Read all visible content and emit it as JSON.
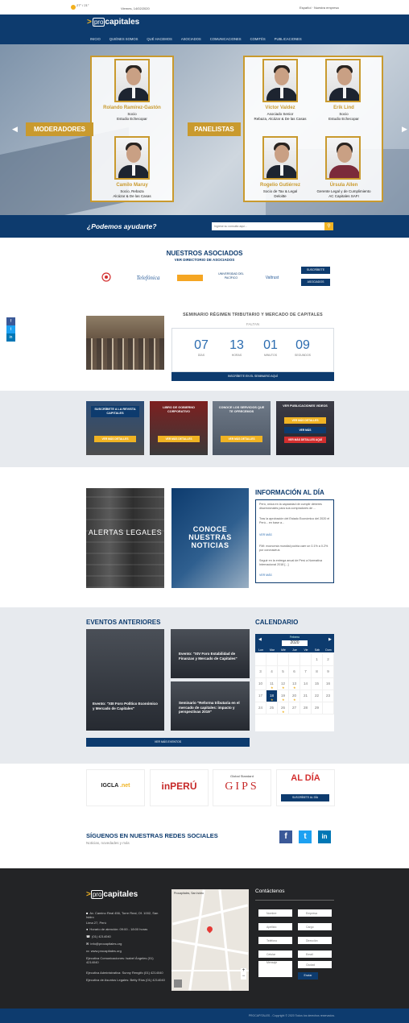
{
  "topbar": {
    "temp": "27° / 21°",
    "temp_sub": "Lima",
    "date": "Viernes, 14/02/2020",
    "right": "Español · Nuestra empresa"
  },
  "header": {
    "logo_pro": "pro",
    "logo_rest": "capitales"
  },
  "menu": [
    "INICIO",
    "QUIÉNES SOMOS",
    "QUÉ HACEMOS",
    "ASOCIADOS",
    "COMUNICACIONES",
    "COMITÉS",
    "PUBLICACIONES"
  ],
  "hero": {
    "moderadores_label": "MODERADORES",
    "panelistas_label": "PANELISTAS",
    "moderadores": [
      {
        "name": "Rolando Ramírez-Gastón",
        "role1": "Socio",
        "role2": "Estudio Echecopar"
      },
      {
        "name": "Camilo Maruy",
        "role1": "Socio, Rebaza",
        "role2": "Alcázar & De las Casas"
      }
    ],
    "panelistas": [
      {
        "name": "Víctor Valdez",
        "role1": "Asociado Senior",
        "role2": "Rebaza, Alcázar & De las Casas"
      },
      {
        "name": "Erik Lind",
        "role1": "Socio",
        "role2": "Estudio Echecopar"
      },
      {
        "name": "Rogelio Gutiérrez",
        "role1": "Socio de Tax & Legal",
        "role2": "Deloitte"
      },
      {
        "name": "Úrsula Allen",
        "role1": "Gerente Legal y de Cumplimiento",
        "role2": "AC Capitales SAFI"
      }
    ]
  },
  "help": {
    "question": "¿Podemos ayudarte?",
    "placeholder": "Ingrese su consulta aquí..."
  },
  "associates": {
    "title": "NUESTROS ASOCIADOS",
    "subtitle": "VER DIRECTORIO DE ASOCIADOS",
    "logos": [
      "",
      "Telefónica",
      "",
      "UNIVERSIDAD DEL PACÍFICO",
      "Valtrust"
    ],
    "btn1": "SUSCRÍBETE",
    "btn2": "ASOCIADOS"
  },
  "side_social": [
    "f",
    "t",
    "in"
  ],
  "seminar": {
    "title": "SEMINARIO RÉGIMEN TRIBUTARIO Y MERCADO DE CAPITALES",
    "subtitle": "FALTAN",
    "countdown": [
      {
        "value": "07",
        "label": "DÍAS"
      },
      {
        "value": "13",
        "label": "HORAS"
      },
      {
        "value": "01",
        "label": "MINUTOS"
      },
      {
        "value": "09",
        "label": "SEGUNDOS"
      }
    ],
    "button": "INSCRÍBETE EN EL SEMINARIO AQUÍ"
  },
  "tiles": [
    {
      "caption": "SUSCRÍBETE A LA REVISTA CAPITALES",
      "button": "VER MÁS DETALLES"
    },
    {
      "caption": "LIBRO DE GOBIERNO CORPORATIVO",
      "button": "VER MÁS DETALLES"
    },
    {
      "caption": "CONOCE LOS SERVICIOS QUE TE OFRECEMOS",
      "button": "VER MÁS DETALLES"
    },
    {
      "caption": "VER PUBLICACIONES VIDEOS",
      "button": "VER MÁS DETALLES",
      "button2": "VER MÁS",
      "button3": "VER MÁS DETALLES AQUÍ"
    }
  ],
  "info": {
    "alertas": "ALERTAS LEGALES",
    "noticias": "CONOCE NUESTRAS NOTICIAS",
    "title": "INFORMACIÓN AL DÍA",
    "items": [
      "Perú, única en la capacidad de cumplir deberes discrecionales para sus compradores de ...",
      "Tras la aprobación del Estado Económico del 2020 el Perú... en base a...",
      "VER MÁS",
      "FMI: economía mundial podría caer un 0.1% a 0.2% por coronavirus",
      "Seguir en la entrega anual de Perú a Normativa Internacional 2018 [...]",
      "VER MÁS"
    ]
  },
  "events": {
    "title": "EVENTOS ANTERIORES",
    "items": [
      "Evento: \"XIII Foro Político Económico y Mercado de Capitales\"",
      "Evento: \"XIV Foro Estabilidad de Finanzas y Mercado de Capitales\"",
      "Seminario \"Reforma tributaria en el mercado de capitales: impacto y perspectivas 2019\""
    ],
    "button": "VER MÁS EVENTOS"
  },
  "calendar": {
    "title": "CALENDARIO",
    "month": "Febrero",
    "year": "2020",
    "dow": [
      "Lun",
      "Mar",
      "Mié",
      "Jue",
      "Vie",
      "Sáb",
      "Dom"
    ],
    "days": [
      "",
      "",
      "",
      "",
      "",
      "1",
      "2",
      "3",
      "4",
      "5",
      "6",
      "7",
      "8",
      "9",
      "10",
      "11",
      "12",
      "13",
      "14",
      "15",
      "16",
      "17",
      "18",
      "19",
      "20",
      "21",
      "22",
      "23",
      "24",
      "25",
      "26",
      "27",
      "28",
      "29",
      ""
    ],
    "event_days": [
      "11",
      "12",
      "13",
      "18",
      "19",
      "20",
      "26"
    ],
    "today": "18"
  },
  "partners": {
    "igcla": "IGCLA",
    "igcla_sub": ".net",
    "inperu": "inPERÚ",
    "gips_top": "Global Standard",
    "gips": "GIPS",
    "aldia": "AL DÍA",
    "aldia_btn": "SUSCRÍBETE AL DÍA"
  },
  "social": {
    "title": "SÍGUENOS EN NUESTRAS REDES SOCIALES",
    "subtitle": "Noticias, novedades y más",
    "icons": [
      "f",
      "t",
      "in"
    ]
  },
  "footer": {
    "logo_pro": "pro",
    "logo_rest": "capitales",
    "lines": [
      "Av. Camino Real 456, Torre Real, Of. 1002, San Isidro",
      "Lima 27, Perú",
      "Horario de atención: 09:00 - 18:00 horas",
      "(01) 4214040",
      "info@procapitales.org",
      "www.procapitales.org",
      "Ejecutiva Comunicaciones: Isabel Ángeles (01) 4214040",
      "Ejecutiva Administrativa: Sunny Rengifo (01) 4214040",
      "Ejecutiva de Asuntos Legales: Betty Ríos (01) 4214040"
    ],
    "map_label": "Procapitales, San Isidro",
    "contact_title": "Contáctenos",
    "fields": [
      "Nombre",
      "Empresa",
      "Apellido",
      "Cargo",
      "Teléfono",
      "Dirección",
      "Celular",
      "Email",
      "Mensaje",
      "Ciudad"
    ],
    "send": "Enviar",
    "copyright": "PROCAPITALES - Copyright © 2020 Todos los derechos reservados."
  },
  "colors": {
    "navy": "#0d3b6e",
    "gold": "#c99a2e",
    "yellow": "#f0b323"
  }
}
